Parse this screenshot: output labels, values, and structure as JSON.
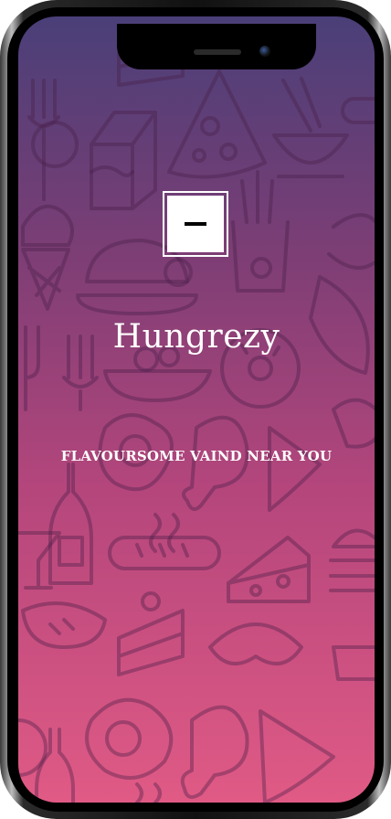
{
  "app": {
    "title": "Hungrezy",
    "tagline": "FLAVOURSOME VAIND NEAR YOU",
    "logo_icon": "logo-minus-icon"
  },
  "colors": {
    "gradient_top": "#4a3f78",
    "gradient_bottom": "#e05a85",
    "text": "#ffffff"
  },
  "background_pattern_icons": [
    "fork-icon",
    "cake-slice-icon",
    "milk-carton-icon",
    "pizza-slice-icon",
    "noodle-bowl-icon",
    "cupcake-icon",
    "ice-cream-cone-icon",
    "roast-chicken-icon",
    "french-fries-icon",
    "fork-knife-icon",
    "salad-bowl-icon",
    "donut-icon",
    "croissant-icon",
    "fried-egg-icon",
    "chicken-leg-icon",
    "wine-bottle-icon",
    "cocktail-glass-icon",
    "sausage-icon",
    "cheese-icon",
    "burger-icon",
    "steak-icon"
  ]
}
